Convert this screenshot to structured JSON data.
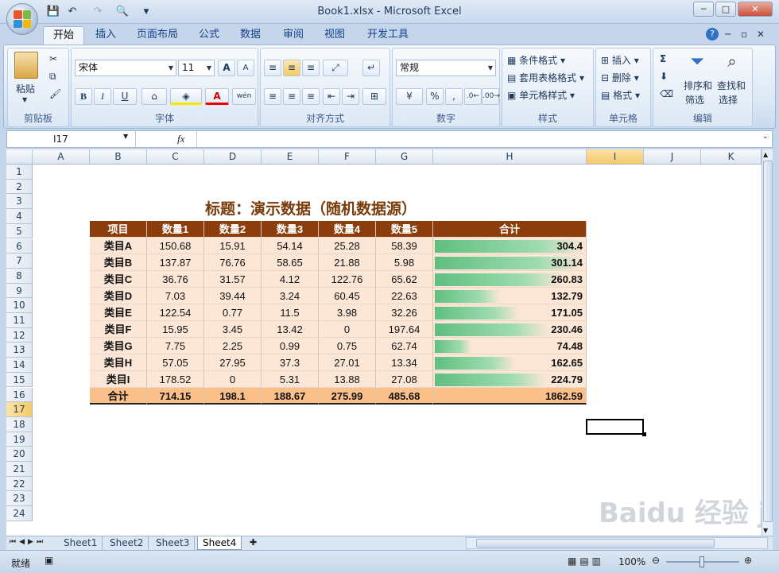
{
  "window": {
    "title": "Book1.xlsx - Microsoft Excel",
    "minimize": "─",
    "restore": "□",
    "close": "✕",
    "doc_minimize": "─",
    "doc_restore": "▫",
    "doc_close": "✕"
  },
  "tabs": [
    "开始",
    "插入",
    "页面布局",
    "公式",
    "数据",
    "审阅",
    "视图",
    "开发工具"
  ],
  "ribbon": {
    "clipboard": {
      "label": "剪贴板",
      "paste": "粘贴"
    },
    "font": {
      "label": "字体",
      "name": "宋体",
      "size": "11",
      "bold": "B",
      "italic": "I",
      "underline": "U",
      "grow": "A",
      "shrink": "A",
      "phonetic": "wén"
    },
    "alignment": {
      "label": "对齐方式"
    },
    "number": {
      "label": "数字",
      "format": "常规",
      "percent": "%",
      "comma": ","
    },
    "styles": {
      "label": "样式",
      "conditional": "条件格式",
      "table": "套用表格格式",
      "cell": "单元格样式"
    },
    "cells": {
      "label": "单元格",
      "insert": "插入",
      "delete": "删除",
      "format": "格式"
    },
    "editing": {
      "label": "编辑",
      "sigma": "Σ",
      "sort": "排序和",
      "sort2": "筛选",
      "find": "查找和",
      "find2": "选择"
    }
  },
  "formula_bar": {
    "name_box": "I17",
    "fx": "fx",
    "value": ""
  },
  "columns": [
    "A",
    "B",
    "C",
    "D",
    "E",
    "F",
    "G",
    "H",
    "I",
    "J",
    "K"
  ],
  "selected_column": "I",
  "rows": [
    "1",
    "2",
    "3",
    "4",
    "5",
    "6",
    "7",
    "8",
    "9",
    "10",
    "11",
    "12",
    "13",
    "14",
    "15",
    "16",
    "17",
    "18",
    "19",
    "20",
    "21",
    "22",
    "23",
    "24"
  ],
  "selected_row": "17",
  "sheet": {
    "title": "标题：演示数据（随机数据源）",
    "headers": [
      "项目",
      "数量1",
      "数量2",
      "数量3",
      "数量4",
      "数量5",
      "合计"
    ],
    "data": [
      [
        "类目A",
        "150.68",
        "15.91",
        "54.14",
        "25.28",
        "58.39",
        "304.4"
      ],
      [
        "类目B",
        "137.87",
        "76.76",
        "58.65",
        "21.88",
        "5.98",
        "301.14"
      ],
      [
        "类目C",
        "36.76",
        "31.57",
        "4.12",
        "122.76",
        "65.62",
        "260.83"
      ],
      [
        "类目D",
        "7.03",
        "39.44",
        "3.24",
        "60.45",
        "22.63",
        "132.79"
      ],
      [
        "类目E",
        "122.54",
        "0.77",
        "11.5",
        "3.98",
        "32.26",
        "171.05"
      ],
      [
        "类目F",
        "15.95",
        "3.45",
        "13.42",
        "0",
        "197.64",
        "230.46"
      ],
      [
        "类目G",
        "7.75",
        "2.25",
        "0.99",
        "0.75",
        "62.74",
        "74.48"
      ],
      [
        "类目H",
        "57.05",
        "27.95",
        "37.3",
        "27.01",
        "13.34",
        "162.65"
      ],
      [
        "类目I",
        "178.52",
        "0",
        "5.31",
        "13.88",
        "27.08",
        "224.79"
      ]
    ],
    "totals": [
      "合计",
      "714.15",
      "198.1",
      "188.67",
      "275.99",
      "485.68",
      "1862.59"
    ],
    "bar_max": 304.4,
    "bar_color": "#5fbf7f"
  },
  "sheet_tabs": [
    "Sheet1",
    "Sheet2",
    "Sheet3",
    "Sheet4"
  ],
  "active_sheet": "Sheet4",
  "status": {
    "ready": "就绪",
    "zoom": "100%"
  },
  "watermark": "Baidu 经验 jingyan.baidu.com"
}
